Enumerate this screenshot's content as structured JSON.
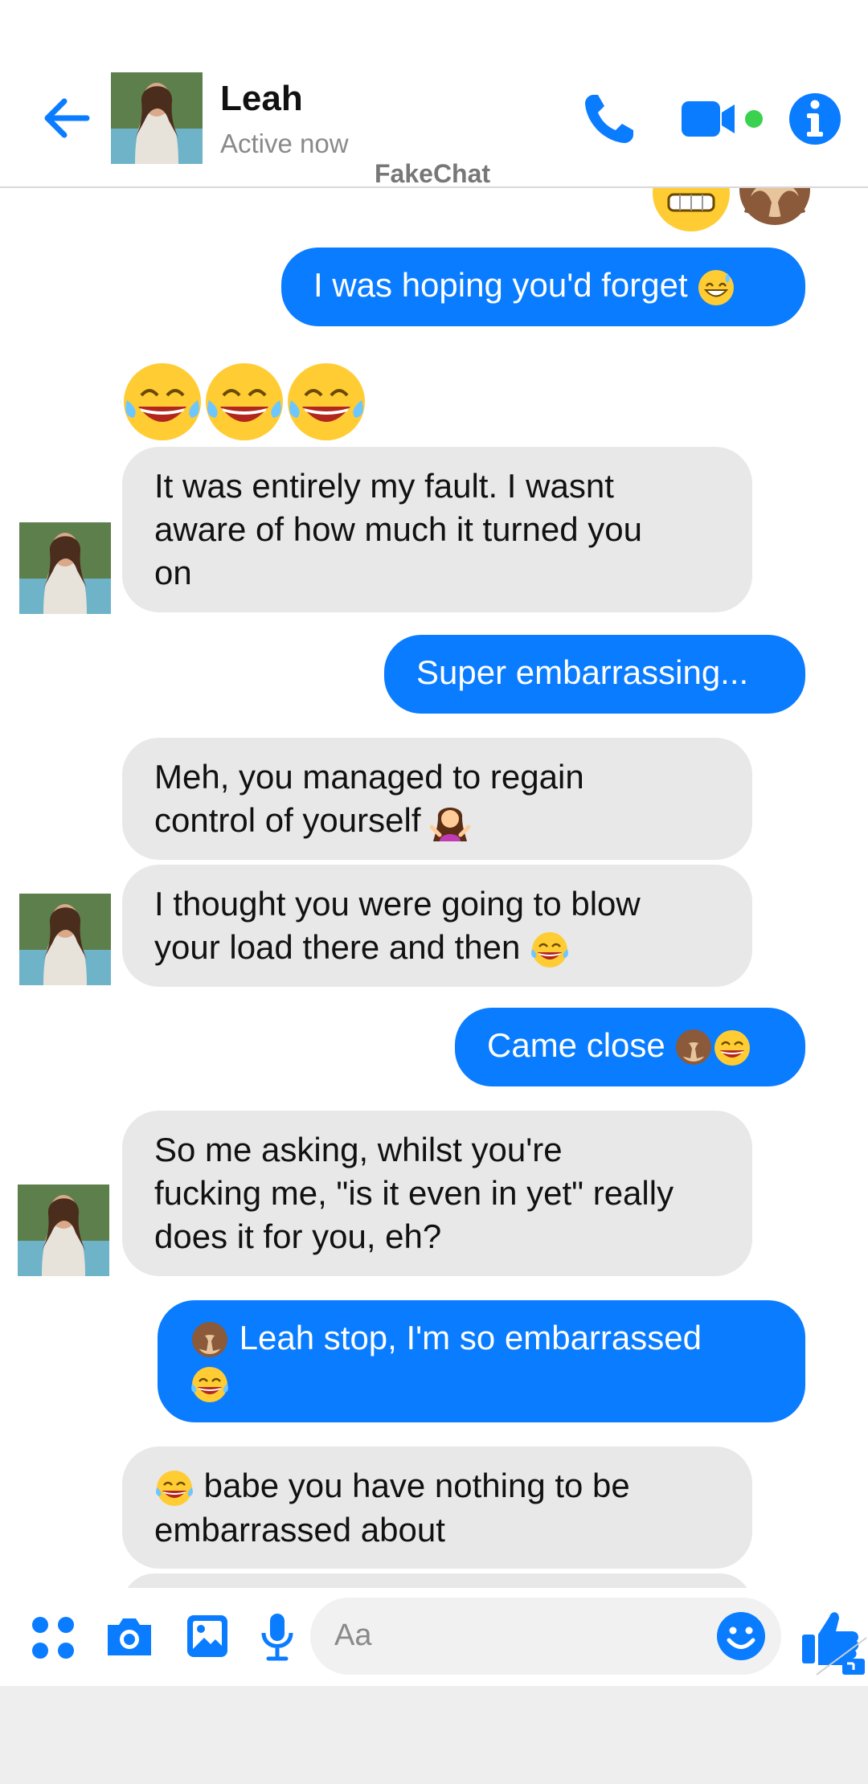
{
  "header": {
    "name": "Leah",
    "status": "Active now",
    "watermark": "FakeChat"
  },
  "messages": {
    "m1": "I was hoping you'd forget",
    "m2_line1": "It was entirely my fault. I wasnt",
    "m2_line2": "aware of how much it turned you",
    "m2_line3": "on",
    "m3": "Super embarrassing...",
    "m4_line1": "Meh, you managed to regain",
    "m4_line2": "control of yourself",
    "m5_line1": "I thought you were going to blow",
    "m5_line2": "your load there and then",
    "m6": "Came close",
    "m7_line1": "So me asking, whilst you're",
    "m7_line2": "fucking me, \"is it even in yet\" really",
    "m7_line3": "does it for you, eh?",
    "m8_line1": "Leah stop, I'm so embarrassed",
    "m9_line1": "babe you have nothing to be",
    "m9_line2": "embarrassed about"
  },
  "composer": {
    "placeholder": "Aa"
  },
  "colors": {
    "accent": "#0a7cff",
    "received_bubble": "#e8e8e8",
    "online_dot": "#3ad14f"
  },
  "icons": [
    "back-arrow-icon",
    "phone-icon",
    "video-camera-icon",
    "info-icon",
    "apps-icon",
    "camera-icon",
    "gallery-icon",
    "microphone-icon",
    "smiley-icon",
    "thumbs-up-icon"
  ]
}
